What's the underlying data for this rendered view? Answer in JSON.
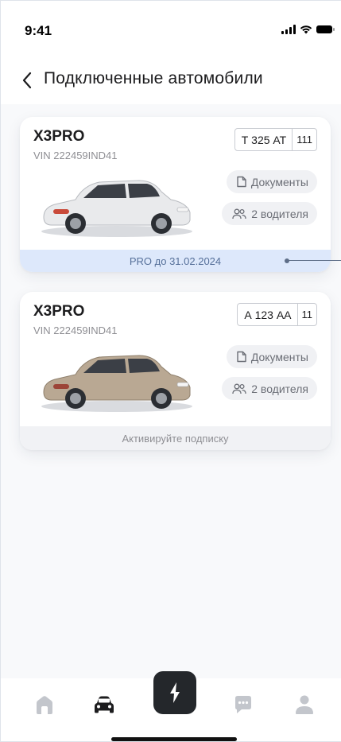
{
  "status_bar": {
    "time": "9:41"
  },
  "header": {
    "title": "Подключенные автомобили"
  },
  "cars": [
    {
      "model": "X3PRO",
      "vin": "VIN 222459IND41",
      "plate_number": "Т 325 АТ",
      "plate_region": "111",
      "color": "#e9eaec",
      "documents_label": "Документы",
      "drivers_label": "2 водителя",
      "status": "PRO до 31.02.2024"
    },
    {
      "model": "X3PRO",
      "vin": "VIN 222459IND41",
      "plate_number": "А 123 АА",
      "plate_region": "11",
      "color": "#b9a893",
      "documents_label": "Документы",
      "drivers_label": "2 водителя",
      "status": "Активируйте подписку"
    }
  ],
  "tab_bar": {
    "items": [
      "home-icon",
      "car-icon",
      "brand-logo-icon",
      "chat-icon",
      "profile-icon"
    ],
    "active": "car-icon"
  },
  "colors": {
    "accent_dark": "#24272b",
    "pro_footer_bg": "#dde8fb",
    "inactive_icon": "#c3c6cc"
  }
}
